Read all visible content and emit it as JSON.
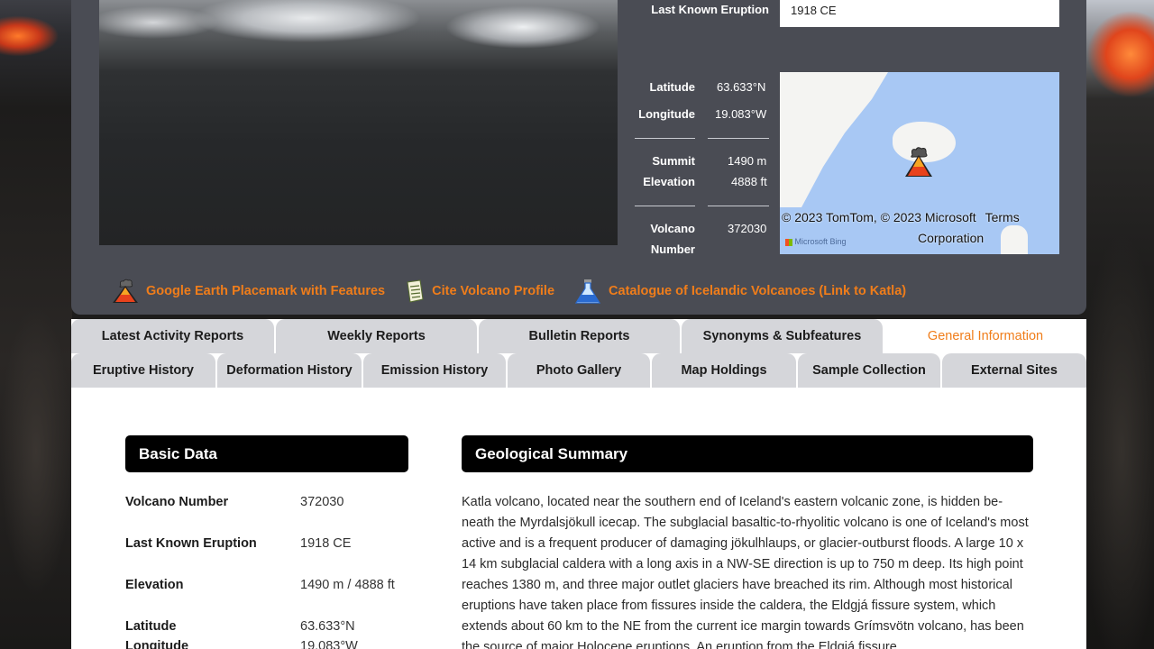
{
  "info": {
    "last_eruption_label": "Last Known Eruption",
    "last_eruption_value": "1918 CE",
    "latitude_label": "Latitude",
    "latitude_value": "63.633°N",
    "longitude_label": "Longitude",
    "longitude_value": "19.083°W",
    "summit_label": "Summit",
    "elevation_label": "Elevation",
    "summit_m": "1490 m",
    "summit_ft": "4888 ft",
    "volcano_label": "Volcano",
    "number_label": "Number",
    "volcano_number": "372030"
  },
  "map": {
    "attribution_1": "© 2023 TomTom, © 2023 Microsoft",
    "terms": "Terms",
    "attribution_2": "Corporation",
    "bing": "Microsoft Bing"
  },
  "links": [
    {
      "label": "Google Earth Placemark with Features",
      "icon": "volcano-icon"
    },
    {
      "label": "Cite Volcano Profile",
      "icon": "document-icon"
    },
    {
      "label": "Catalogue of Icelandic Volcanoes (Link to Katla)",
      "icon": "flask-icon"
    }
  ],
  "tabs_row1": [
    "Latest Activity Reports",
    "Weekly Reports",
    "Bulletin Reports",
    "Synonyms & Subfeatures",
    "General Information"
  ],
  "tabs_row2": [
    "Eruptive History",
    "Deformation History",
    "Emission History",
    "Photo Gallery",
    "Map Holdings",
    "Sample Collection",
    "External Sites"
  ],
  "active_tab": "General Information",
  "basic_data": {
    "title": "Basic Data",
    "rows": [
      {
        "label": "Volcano Number",
        "value": "372030"
      },
      {
        "label": "Last Known Eruption",
        "value": "1918 CE"
      },
      {
        "label": "Elevation",
        "value": "1490 m / 4888 ft"
      },
      {
        "label": "Latitude",
        "value": "63.633°N"
      },
      {
        "label": "Longitude",
        "value": "19.083°W"
      }
    ]
  },
  "geo_summary": {
    "title": "Geological Summary",
    "text": "Katla volcano, located near the southern end of Iceland's eastern volcanic zone, is hidden be-neath the Myrdalsjökull icecap. The subglacial basaltic-to-rhyolitic volcano is one of Iceland's most active and is a frequent producer of damaging jökulhlaups, or glacier-outburst floods. A large 10 x 14 km subglacial caldera with a long axis in a NW-SE direction is up to 750 m deep. Its high point reaches 1380 m, and three major outlet glaciers have breached its rim. Although most historical eruptions have taken place from fissures inside the caldera, the Eldgjá fissure system, which extends about 60 km to the NE from the current ice margin towards Grímsvötn volcano, has been the source of major Holocene eruptions. An eruption from the Eldgjá fissure"
  }
}
